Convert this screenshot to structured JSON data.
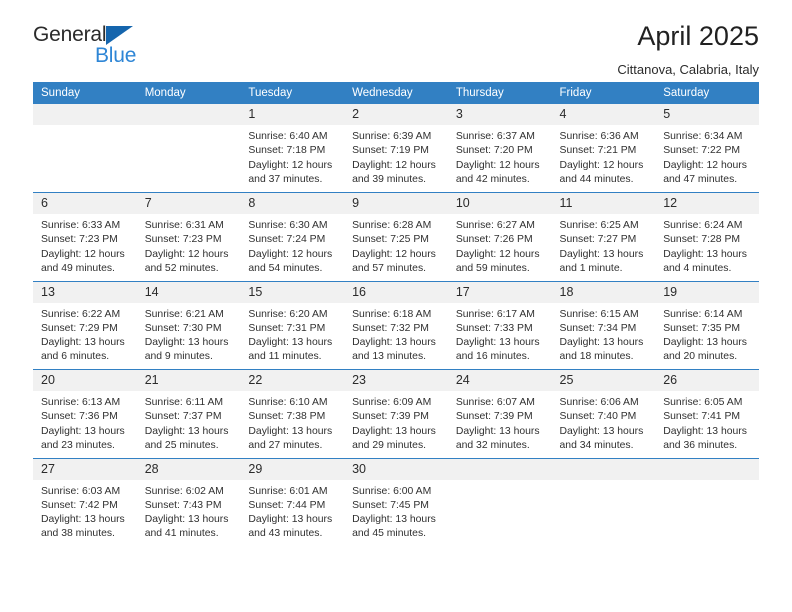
{
  "brand": {
    "name_top": "General",
    "name_bottom": "Blue",
    "triangle_color": "#1565ad",
    "blue_text_color": "#2e86d6"
  },
  "header": {
    "title": "April 2025",
    "subtitle": "Cittanova, Calabria, Italy"
  },
  "theme": {
    "header_blue": "#3280c3",
    "daynum_gray": "#f1f1f1",
    "text": "#303030"
  },
  "calendar": {
    "weekday_headers": [
      "Sunday",
      "Monday",
      "Tuesday",
      "Wednesday",
      "Thursday",
      "Friday",
      "Saturday"
    ],
    "weeks": [
      [
        {
          "day": "",
          "lines": []
        },
        {
          "day": "",
          "lines": []
        },
        {
          "day": "1",
          "lines": [
            "Sunrise: 6:40 AM",
            "Sunset: 7:18 PM",
            "Daylight: 12 hours",
            "and 37 minutes."
          ]
        },
        {
          "day": "2",
          "lines": [
            "Sunrise: 6:39 AM",
            "Sunset: 7:19 PM",
            "Daylight: 12 hours",
            "and 39 minutes."
          ]
        },
        {
          "day": "3",
          "lines": [
            "Sunrise: 6:37 AM",
            "Sunset: 7:20 PM",
            "Daylight: 12 hours",
            "and 42 minutes."
          ]
        },
        {
          "day": "4",
          "lines": [
            "Sunrise: 6:36 AM",
            "Sunset: 7:21 PM",
            "Daylight: 12 hours",
            "and 44 minutes."
          ]
        },
        {
          "day": "5",
          "lines": [
            "Sunrise: 6:34 AM",
            "Sunset: 7:22 PM",
            "Daylight: 12 hours",
            "and 47 minutes."
          ]
        }
      ],
      [
        {
          "day": "6",
          "lines": [
            "Sunrise: 6:33 AM",
            "Sunset: 7:23 PM",
            "Daylight: 12 hours",
            "and 49 minutes."
          ]
        },
        {
          "day": "7",
          "lines": [
            "Sunrise: 6:31 AM",
            "Sunset: 7:23 PM",
            "Daylight: 12 hours",
            "and 52 minutes."
          ]
        },
        {
          "day": "8",
          "lines": [
            "Sunrise: 6:30 AM",
            "Sunset: 7:24 PM",
            "Daylight: 12 hours",
            "and 54 minutes."
          ]
        },
        {
          "day": "9",
          "lines": [
            "Sunrise: 6:28 AM",
            "Sunset: 7:25 PM",
            "Daylight: 12 hours",
            "and 57 minutes."
          ]
        },
        {
          "day": "10",
          "lines": [
            "Sunrise: 6:27 AM",
            "Sunset: 7:26 PM",
            "Daylight: 12 hours",
            "and 59 minutes."
          ]
        },
        {
          "day": "11",
          "lines": [
            "Sunrise: 6:25 AM",
            "Sunset: 7:27 PM",
            "Daylight: 13 hours",
            "and 1 minute."
          ]
        },
        {
          "day": "12",
          "lines": [
            "Sunrise: 6:24 AM",
            "Sunset: 7:28 PM",
            "Daylight: 13 hours",
            "and 4 minutes."
          ]
        }
      ],
      [
        {
          "day": "13",
          "lines": [
            "Sunrise: 6:22 AM",
            "Sunset: 7:29 PM",
            "Daylight: 13 hours",
            "and 6 minutes."
          ]
        },
        {
          "day": "14",
          "lines": [
            "Sunrise: 6:21 AM",
            "Sunset: 7:30 PM",
            "Daylight: 13 hours",
            "and 9 minutes."
          ]
        },
        {
          "day": "15",
          "lines": [
            "Sunrise: 6:20 AM",
            "Sunset: 7:31 PM",
            "Daylight: 13 hours",
            "and 11 minutes."
          ]
        },
        {
          "day": "16",
          "lines": [
            "Sunrise: 6:18 AM",
            "Sunset: 7:32 PM",
            "Daylight: 13 hours",
            "and 13 minutes."
          ]
        },
        {
          "day": "17",
          "lines": [
            "Sunrise: 6:17 AM",
            "Sunset: 7:33 PM",
            "Daylight: 13 hours",
            "and 16 minutes."
          ]
        },
        {
          "day": "18",
          "lines": [
            "Sunrise: 6:15 AM",
            "Sunset: 7:34 PM",
            "Daylight: 13 hours",
            "and 18 minutes."
          ]
        },
        {
          "day": "19",
          "lines": [
            "Sunrise: 6:14 AM",
            "Sunset: 7:35 PM",
            "Daylight: 13 hours",
            "and 20 minutes."
          ]
        }
      ],
      [
        {
          "day": "20",
          "lines": [
            "Sunrise: 6:13 AM",
            "Sunset: 7:36 PM",
            "Daylight: 13 hours",
            "and 23 minutes."
          ]
        },
        {
          "day": "21",
          "lines": [
            "Sunrise: 6:11 AM",
            "Sunset: 7:37 PM",
            "Daylight: 13 hours",
            "and 25 minutes."
          ]
        },
        {
          "day": "22",
          "lines": [
            "Sunrise: 6:10 AM",
            "Sunset: 7:38 PM",
            "Daylight: 13 hours",
            "and 27 minutes."
          ]
        },
        {
          "day": "23",
          "lines": [
            "Sunrise: 6:09 AM",
            "Sunset: 7:39 PM",
            "Daylight: 13 hours",
            "and 29 minutes."
          ]
        },
        {
          "day": "24",
          "lines": [
            "Sunrise: 6:07 AM",
            "Sunset: 7:39 PM",
            "Daylight: 13 hours",
            "and 32 minutes."
          ]
        },
        {
          "day": "25",
          "lines": [
            "Sunrise: 6:06 AM",
            "Sunset: 7:40 PM",
            "Daylight: 13 hours",
            "and 34 minutes."
          ]
        },
        {
          "day": "26",
          "lines": [
            "Sunrise: 6:05 AM",
            "Sunset: 7:41 PM",
            "Daylight: 13 hours",
            "and 36 minutes."
          ]
        }
      ],
      [
        {
          "day": "27",
          "lines": [
            "Sunrise: 6:03 AM",
            "Sunset: 7:42 PM",
            "Daylight: 13 hours",
            "and 38 minutes."
          ]
        },
        {
          "day": "28",
          "lines": [
            "Sunrise: 6:02 AM",
            "Sunset: 7:43 PM",
            "Daylight: 13 hours",
            "and 41 minutes."
          ]
        },
        {
          "day": "29",
          "lines": [
            "Sunrise: 6:01 AM",
            "Sunset: 7:44 PM",
            "Daylight: 13 hours",
            "and 43 minutes."
          ]
        },
        {
          "day": "30",
          "lines": [
            "Sunrise: 6:00 AM",
            "Sunset: 7:45 PM",
            "Daylight: 13 hours",
            "and 45 minutes."
          ]
        },
        {
          "day": "",
          "lines": []
        },
        {
          "day": "",
          "lines": []
        },
        {
          "day": "",
          "lines": []
        }
      ]
    ]
  }
}
